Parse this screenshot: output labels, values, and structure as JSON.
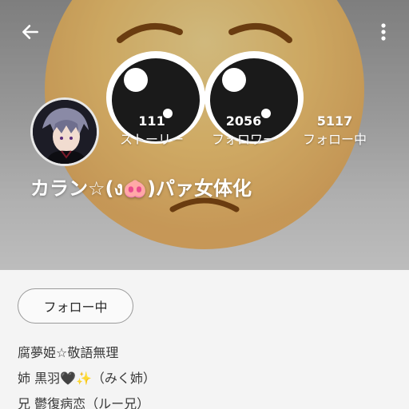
{
  "header": {
    "back_icon": "arrow-left-icon",
    "more_icon": "more-vertical-icon",
    "cover_icon": "pleading-face-emoji"
  },
  "profile": {
    "username": "カラン☆(ง︎🐽)パァ女体化",
    "stats": [
      {
        "count": "111",
        "label": "ストーリー"
      },
      {
        "count": "2056",
        "label": "フォロワー"
      },
      {
        "count": "5117",
        "label": "フォロー中"
      }
    ]
  },
  "actions": {
    "follow_label": "フォロー中"
  },
  "bio": {
    "lines": [
      "腐夢姫☆敬語無理",
      "姉 黒羽🖤✨（みく姉）",
      "兄 鬱復病恋（ルー兄）"
    ]
  },
  "colors": {
    "text_white": "#ffffff",
    "page_bg": "#f4f4f4"
  }
}
